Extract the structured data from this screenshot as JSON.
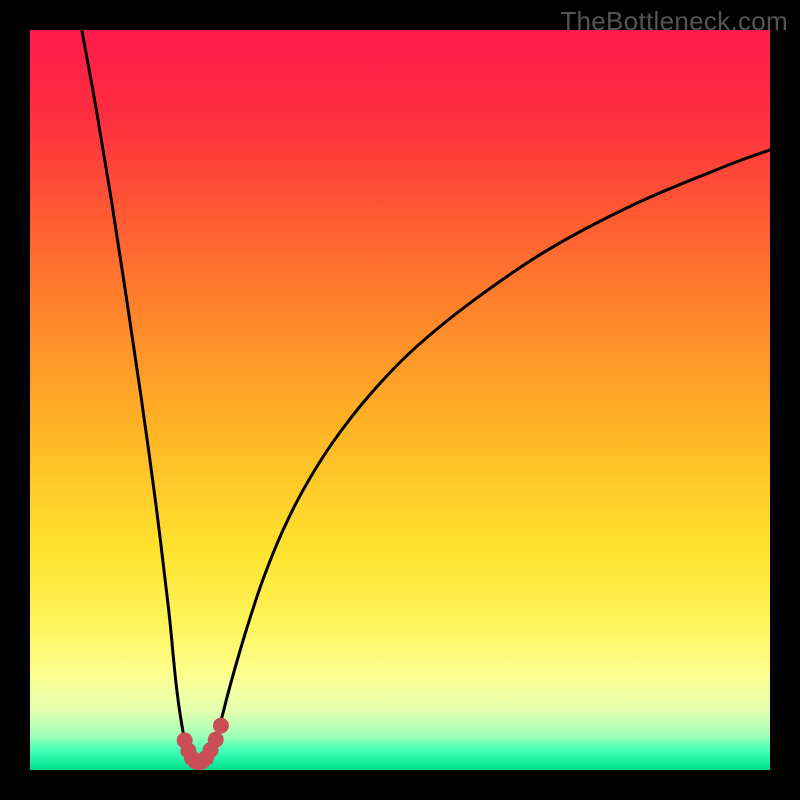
{
  "watermark": "TheBottleneck.com",
  "chart_data": {
    "type": "line",
    "title": "",
    "xlabel": "",
    "ylabel": "",
    "xlim": [
      0,
      100
    ],
    "ylim": [
      0,
      100
    ],
    "grid": false,
    "legend": false,
    "background_gradient": {
      "stops": [
        {
          "offset": 0.0,
          "color": "#ff1a4b"
        },
        {
          "offset": 0.12,
          "color": "#ff2f3f"
        },
        {
          "offset": 0.25,
          "color": "#ff5a33"
        },
        {
          "offset": 0.4,
          "color": "#ff8a2a"
        },
        {
          "offset": 0.55,
          "color": "#ffb726"
        },
        {
          "offset": 0.7,
          "color": "#ffe22e"
        },
        {
          "offset": 0.8,
          "color": "#fff45a"
        },
        {
          "offset": 0.87,
          "color": "#fdff8f"
        },
        {
          "offset": 0.92,
          "color": "#e4ffb0"
        },
        {
          "offset": 0.955,
          "color": "#9cffb8"
        },
        {
          "offset": 0.975,
          "color": "#3dffb6"
        },
        {
          "offset": 1.0,
          "color": "#00e38e"
        }
      ]
    },
    "series": [
      {
        "name": "left-branch",
        "x": [
          7,
          9,
          11,
          13,
          15,
          17,
          18.7,
          19.3,
          19.7,
          20.1,
          20.5,
          20.9,
          21.3
        ],
        "y": [
          100,
          89,
          77,
          64,
          50.5,
          36,
          22,
          16,
          12,
          8.8,
          6.2,
          4.0,
          2.5
        ]
      },
      {
        "name": "valley-marker",
        "x": [
          20.9,
          21.4,
          21.9,
          22.35,
          22.8,
          23.25,
          23.8,
          24.4,
          25.1,
          25.8
        ],
        "y": [
          4.0,
          2.6,
          1.6,
          1.15,
          1.0,
          1.15,
          1.65,
          2.7,
          4.1,
          6.0
        ],
        "style": "thick-red"
      },
      {
        "name": "right-branch",
        "x": [
          25.1,
          25.9,
          26.8,
          28.0,
          29.5,
          31.5,
          34,
          37,
          41,
          46,
          52,
          60,
          70,
          82,
          94,
          100
        ],
        "y": [
          4.1,
          7.0,
          10.5,
          14.8,
          19.8,
          25.8,
          32.0,
          38.0,
          44.4,
          50.8,
          57.0,
          63.5,
          70.3,
          76.6,
          81.6,
          83.8
        ]
      }
    ]
  }
}
